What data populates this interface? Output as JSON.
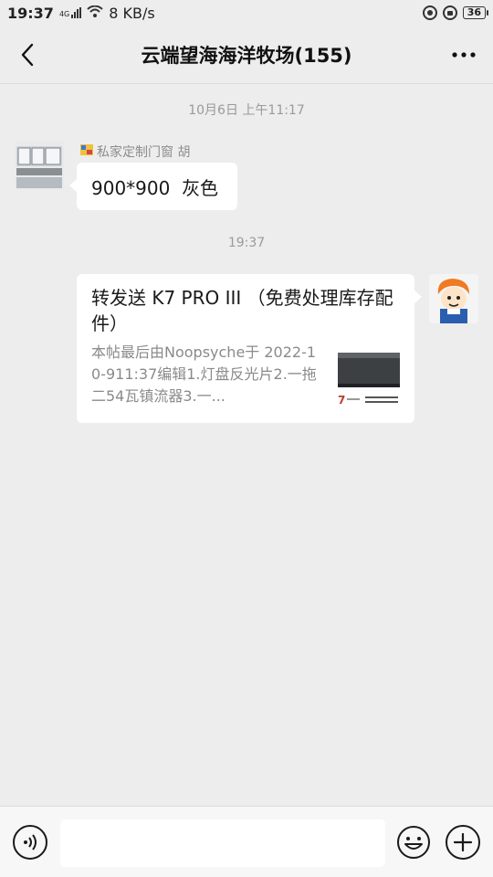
{
  "status_bar": {
    "time": "19:37",
    "network": "4G",
    "speed": "8 KB/s",
    "battery": "36",
    "icons": [
      "signal-icon",
      "wifi-icon",
      "sync-icon",
      "lock-icon",
      "battery-icon"
    ]
  },
  "header": {
    "title": "云端望海海洋牧场(155)",
    "back_icon": "back-arrow-icon",
    "more_icon": "more-icon"
  },
  "messages": [
    {
      "type": "timestamp",
      "text": "10月6日 上午11:17"
    },
    {
      "type": "text",
      "direction": "incoming",
      "sender": "私家定制门窗 胡",
      "sender_badge_icon": "shop-badge-icon",
      "text": "900*900  灰色"
    },
    {
      "type": "timestamp",
      "text": "19:37"
    },
    {
      "type": "link_card",
      "direction": "outgoing",
      "title": "转发送 K7 PRO III （免费处理库存配件）",
      "description": "本帖最后由Noopsyche于 2022-10-911:37编辑1.灯盘反光片2.一拖二54瓦镇流器3.一...",
      "thumbnail_text": "7 ..."
    }
  ],
  "input_bar": {
    "voice_icon": "voice-icon",
    "placeholder": "",
    "emoji_icon": "emoji-icon",
    "plus_icon": "plus-icon"
  }
}
